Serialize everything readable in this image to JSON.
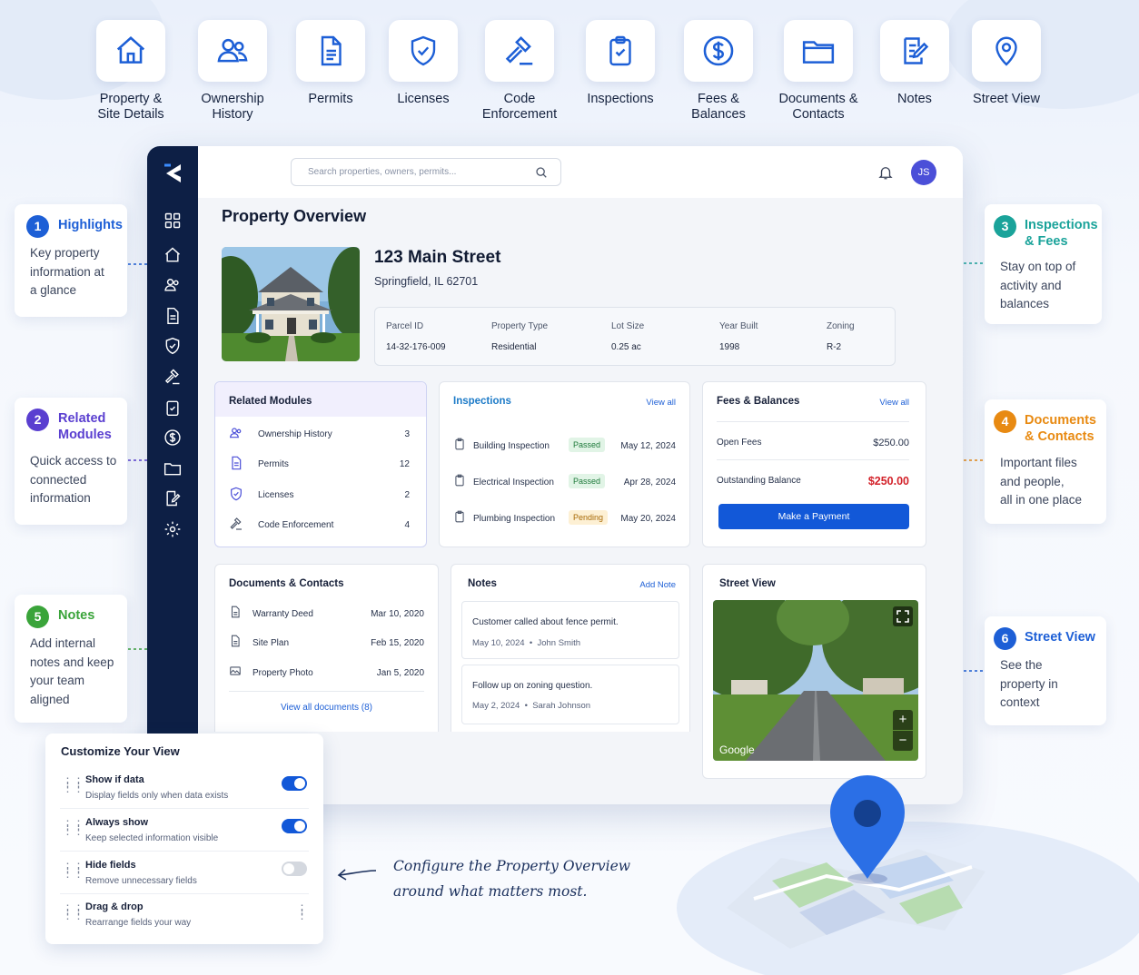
{
  "features": [
    {
      "label": "Property &\nSite Details",
      "icon": "home-icon"
    },
    {
      "label": "Ownership\nHistory",
      "icon": "people-icon"
    },
    {
      "label": "Permits",
      "icon": "document-icon"
    },
    {
      "label": "Licenses",
      "icon": "shield-check-icon"
    },
    {
      "label": "Code\nEnforcement",
      "icon": "gavel-icon"
    },
    {
      "label": "Inspections",
      "icon": "clipboard-check-icon"
    },
    {
      "label": "Fees &\nBalances",
      "icon": "dollar-circle-icon"
    },
    {
      "label": "Documents &\nContacts",
      "icon": "folder-icon"
    },
    {
      "label": "Notes",
      "icon": "note-edit-icon"
    },
    {
      "label": "Street View",
      "icon": "map-pin-icon"
    }
  ],
  "app": {
    "search_placeholder": "Search properties, owners, permits...",
    "avatar": "JS",
    "page_title": "Property Overview",
    "address": "123 Main Street",
    "city": "Springfield, IL 62701",
    "facts": [
      {
        "k": "Parcel ID",
        "v": "14-32-176-009"
      },
      {
        "k": "Property Type",
        "v": "Residential"
      },
      {
        "k": "Lot Size",
        "v": "0.25 ac"
      },
      {
        "k": "Year Built",
        "v": "1998"
      },
      {
        "k": "Zoning",
        "v": "R-2"
      }
    ],
    "related": {
      "title": "Related Modules",
      "items": [
        {
          "label": "Ownership History",
          "count": "3"
        },
        {
          "label": "Permits",
          "count": "12"
        },
        {
          "label": "Licenses",
          "count": "2"
        },
        {
          "label": "Code Enforcement",
          "count": "4"
        }
      ]
    },
    "inspections": {
      "title": "Inspections",
      "view_all": "View all",
      "items": [
        {
          "label": "Building Inspection",
          "status": "Passed",
          "date": "May 12, 2024"
        },
        {
          "label": "Electrical Inspection",
          "status": "Passed",
          "date": "Apr 28, 2024"
        },
        {
          "label": "Plumbing Inspection",
          "status": "Pending",
          "date": "May 20, 2024"
        }
      ]
    },
    "fees": {
      "title": "Fees & Balances",
      "view_all": "View all",
      "open_label": "Open Fees",
      "open_value": "$250.00",
      "out_label": "Outstanding Balance",
      "out_value": "$250.00",
      "pay": "Make a Payment"
    },
    "documents": {
      "title": "Documents & Contacts",
      "items": [
        {
          "label": "Warranty Deed",
          "date": "Mar 10, 2020"
        },
        {
          "label": "Site Plan",
          "date": "Feb 15, 2020"
        },
        {
          "label": "Property Photo",
          "date": "Jan 5, 2020"
        }
      ],
      "view_all": "View all documents (8)"
    },
    "notes": {
      "title": "Notes",
      "add": "Add Note",
      "items": [
        {
          "text": "Customer called about fence permit.",
          "date": "May 10, 2024",
          "author": "John Smith"
        },
        {
          "text": "Follow up on zoning question.",
          "date": "May 2, 2024",
          "author": "Sarah Johnson"
        }
      ]
    },
    "street": {
      "title": "Street View",
      "google": "Google",
      "zoom_in": "+",
      "zoom_out": "−"
    }
  },
  "callouts": [
    {
      "n": "1",
      "title": "Highlights",
      "desc": "Key property\ninformation at\na glance",
      "color": "#1d5fd6"
    },
    {
      "n": "2",
      "title": "Related\nModules",
      "desc": "Quick access to\nconnected\ninformation",
      "color": "#5a3fd0"
    },
    {
      "n": "3",
      "title": "Inspections\n& Fees",
      "desc": "Stay on top of\nactivity and\nbalances",
      "color": "#1aa39a"
    },
    {
      "n": "4",
      "title": "Documents\n& Contacts",
      "desc": "Important files\nand people,\nall in one place",
      "color": "#e88a12"
    },
    {
      "n": "5",
      "title": "Notes",
      "desc": "Add internal\nnotes and keep\nyour team\naligned",
      "color": "#3aa43a"
    },
    {
      "n": "6",
      "title": "Street View",
      "desc": "See the\nproperty in\ncontext",
      "color": "#1d5fd6"
    }
  ],
  "customize": {
    "title": "Customize Your View",
    "rows": [
      {
        "t": "Show if data",
        "s": "Display fields only when data exists",
        "on": true
      },
      {
        "t": "Always show",
        "s": "Keep selected information visible",
        "on": true
      },
      {
        "t": "Hide fields",
        "s": "Remove unnecessary fields",
        "on": false
      },
      {
        "t": "Drag & drop",
        "s": "Rearrange fields your way"
      }
    ]
  },
  "tagline": "Configure the Property Overview\naround what matters most."
}
